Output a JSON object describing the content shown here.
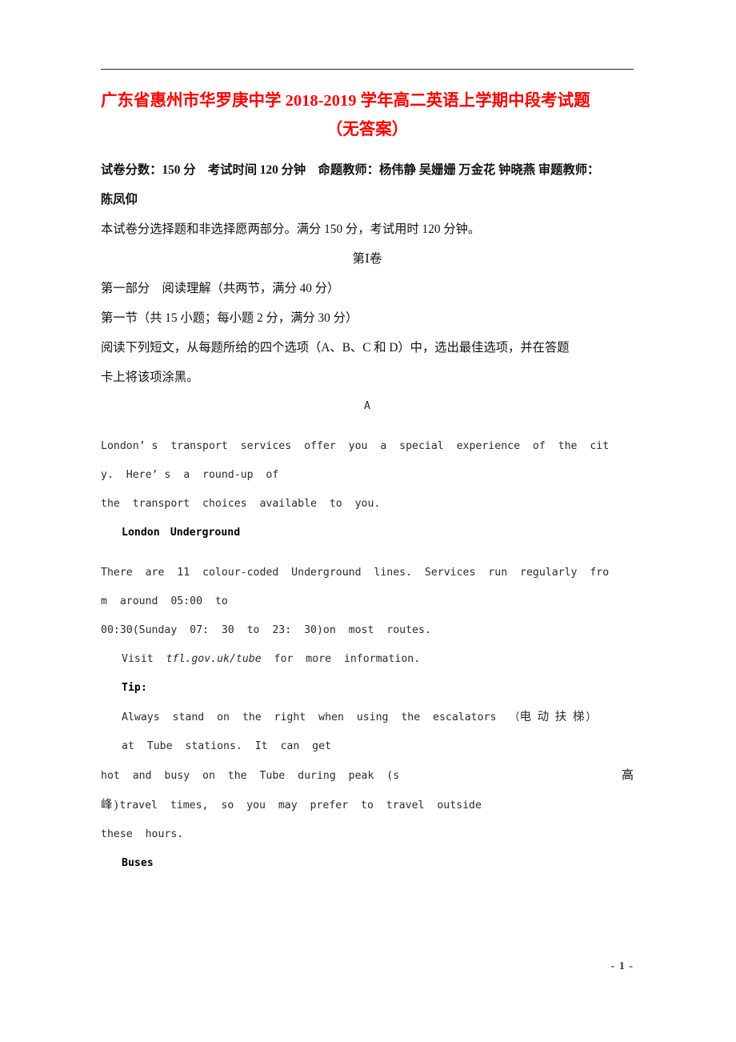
{
  "document": {
    "title_line1": "广东省惠州市华罗庚中学 2018-2019 学年高二英语上学期中段考试题",
    "title_line2": "（无答案）",
    "title_color": "#fe0000",
    "page_number": "- 1 -"
  },
  "exam_info": {
    "line1": "试卷分数：150 分　考试时间 120 分钟　命题教师：杨伟静 吴姗姗 万金花 钟晓燕 审题教师：",
    "line2": "陈凤仰",
    "instructions": "本试卷分选择题和非选择愿两部分。满分 150 分，考试用时 120 分钟。"
  },
  "sections": {
    "paper_label": "第Ⅰ卷",
    "part_one": "第一部分　阅读理解（共两节，满分 40 分）",
    "section_one": "第一节（共 15 小题；每小题 2 分，满分 30 分）",
    "directions_line1": "阅读下列短文，从每题所给的四个选项（A、B、C 和 D）中，选出最佳选项，并在答题",
    "directions_line2": "卡上将该项涂黑。"
  },
  "passage": {
    "label": "A",
    "line1": "London’ s  transport  services  offer  you  a  special  experience  of  the  cit",
    "line2": "y.  Here’ s  a  round-up  of",
    "line3": "the  transport  choices  available  to  you.",
    "heading_underground": "London　Underground",
    "line4": "There  are  11  colour-coded  Underground  lines.  Services  run  regularly  fro",
    "line5": "m  around  05:00  to",
    "line6": "00:30(Sunday  07:  30  to  23:  30)on  most  routes.",
    "visit_prefix": "Visit  ",
    "visit_url": "tfl.gov.uk/tube",
    "visit_suffix": "  for  more  information.",
    "tip_label": "Tip:",
    "tip_line1_en": "Always  stand  on  the  right  when  using  the  escalators  （",
    "tip_line1_cn": "电 动 扶 梯",
    "tip_line1_end": "）",
    "tip_line2": "at  Tube  stations.  It  can  get",
    "tip_line3_left": "hot  and  busy  on  the  Tube  during  peak  (s",
    "tip_line3_right": "高",
    "tip_line4_cn": "峰)",
    "tip_line4_en": "travel  times,  so  you  may  prefer  to  travel  outside",
    "tip_line5": "these  hours.",
    "heading_buses": "Buses"
  }
}
